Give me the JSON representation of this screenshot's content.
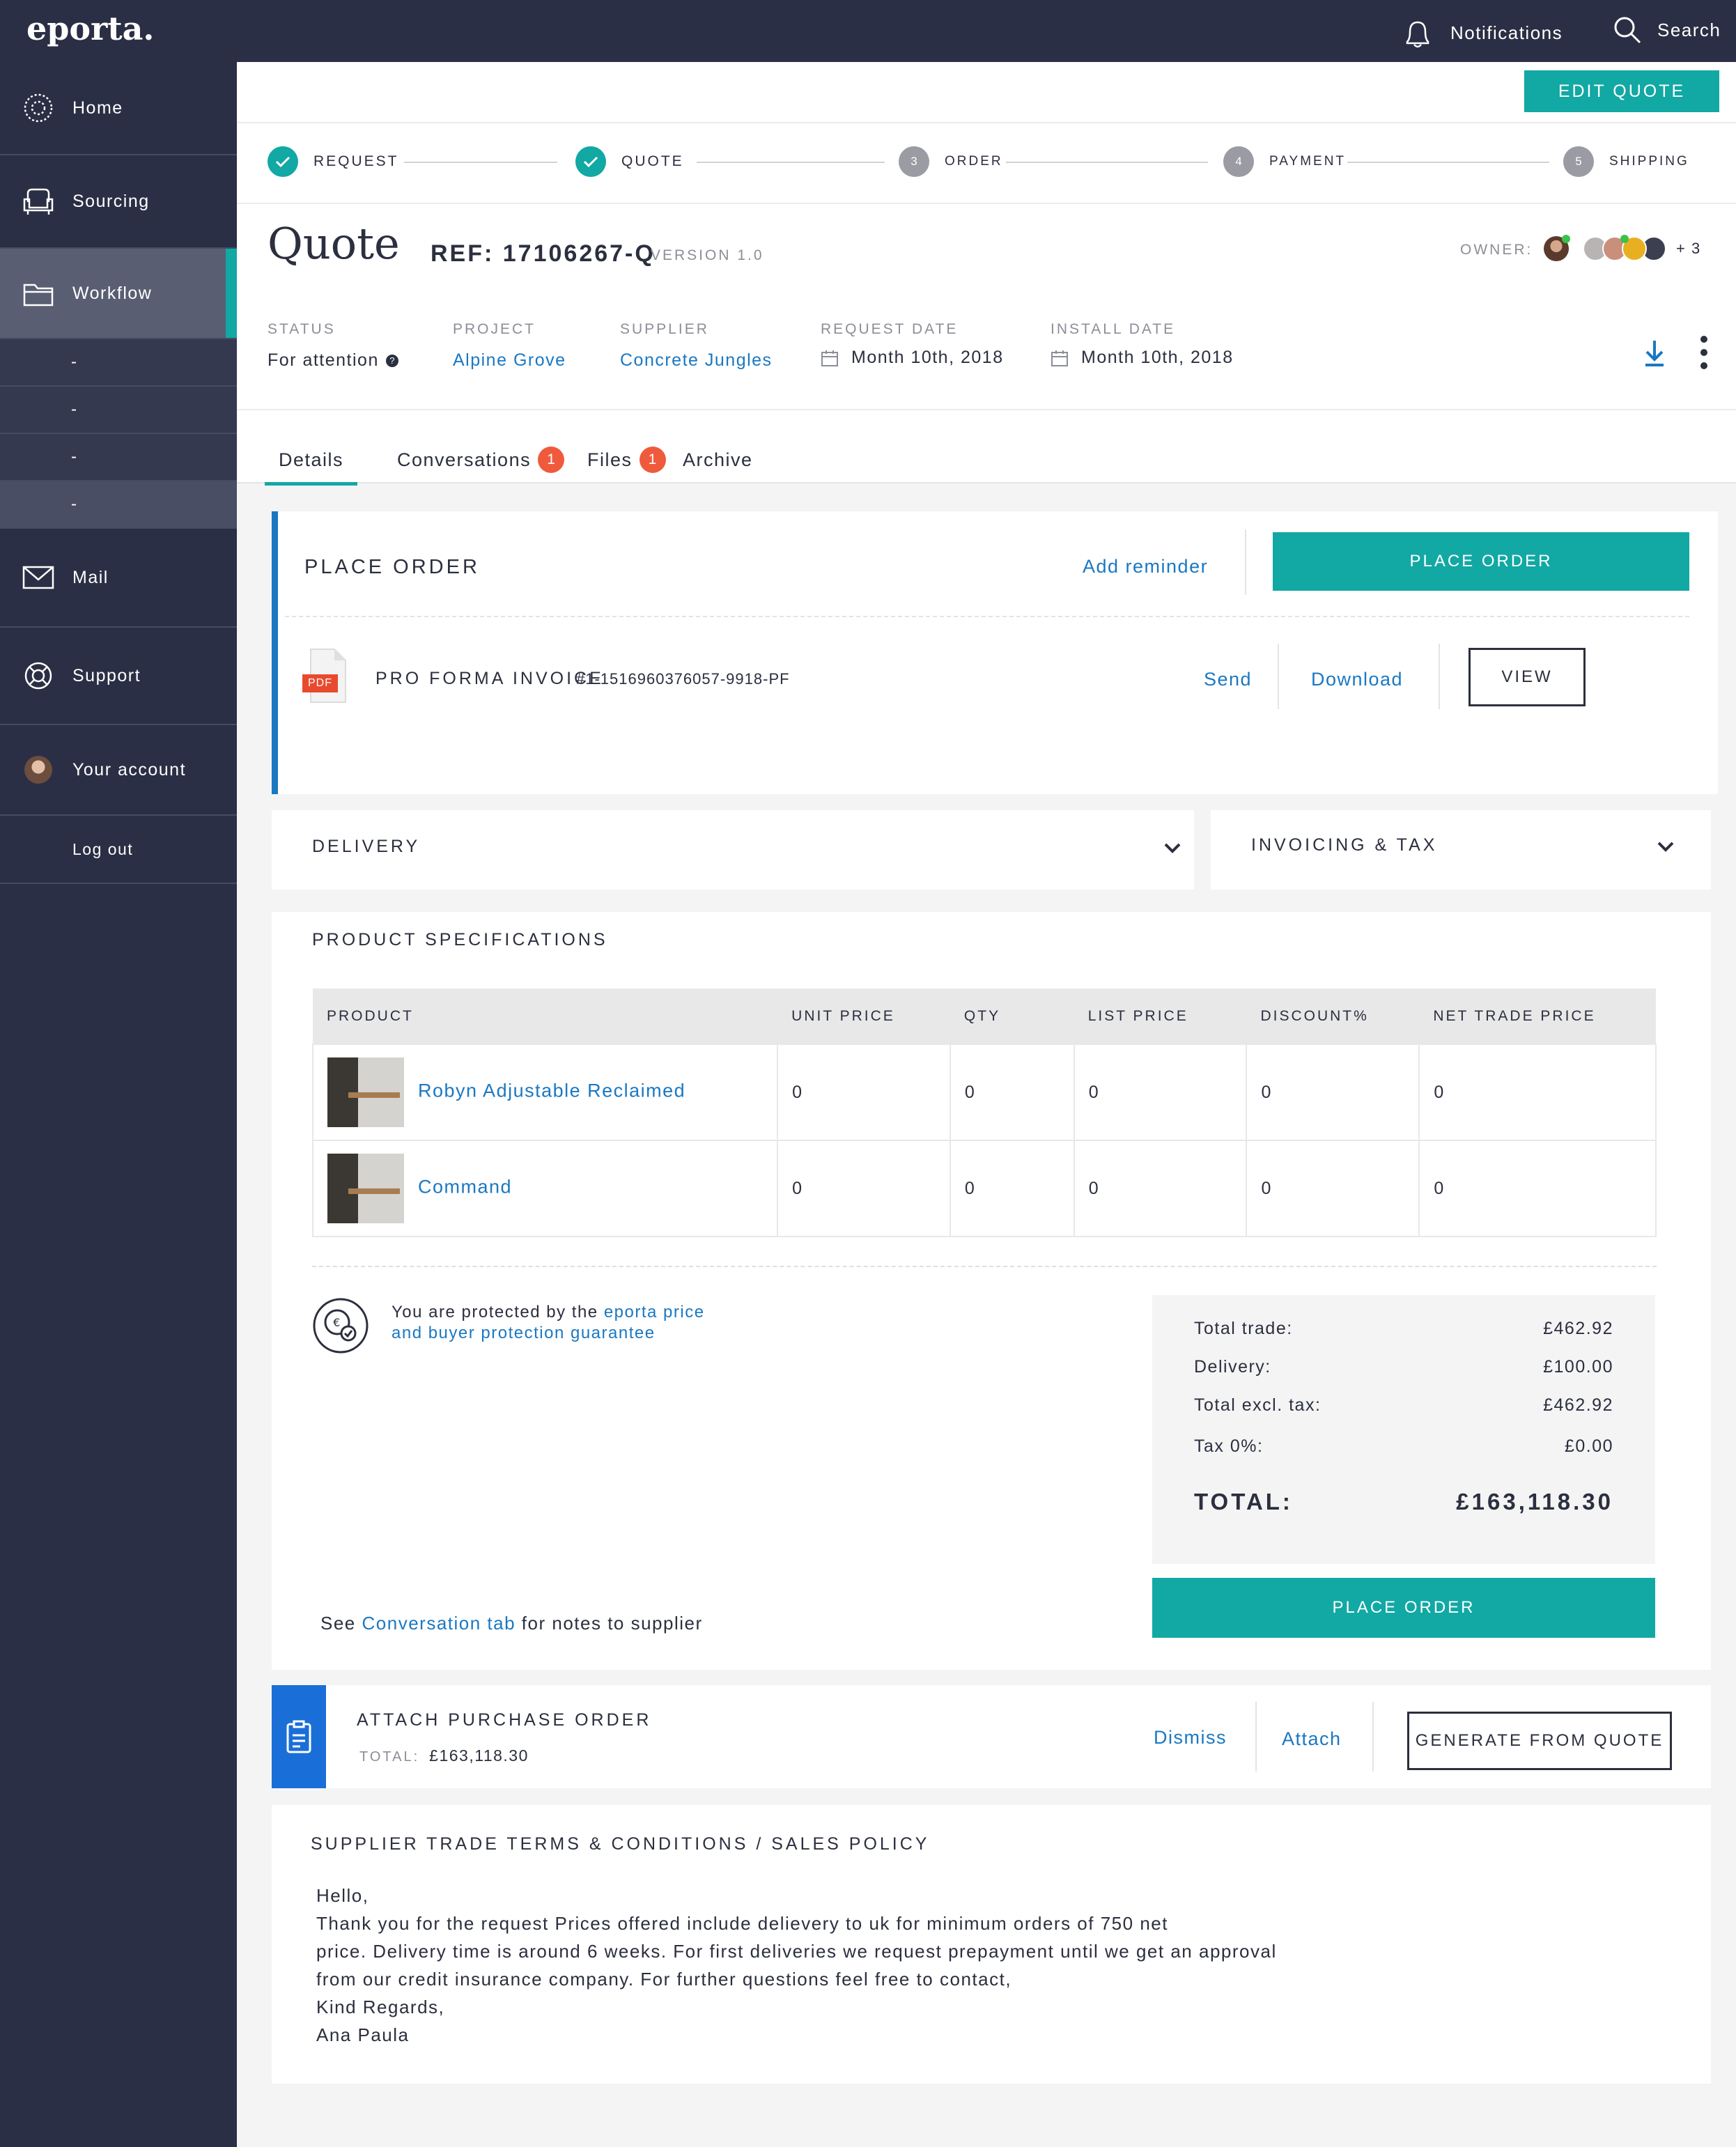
{
  "app": {
    "logo": "eporta."
  },
  "topbar": {
    "notifications": "Notifications",
    "search": "Search"
  },
  "sidebar": {
    "items": [
      {
        "label": "Home",
        "icon": "globe-icon"
      },
      {
        "label": "Sourcing",
        "icon": "armchair-icon"
      },
      {
        "label": "Workflow",
        "icon": "folder-icon"
      },
      {
        "label": "Mail",
        "icon": "envelope-icon"
      },
      {
        "label": "Support",
        "icon": "lifebuoy-icon"
      },
      {
        "label": "Your account",
        "icon": "avatar-icon"
      },
      {
        "label": "Log out"
      }
    ],
    "sub_items": [
      "-",
      "-",
      "-",
      "-"
    ]
  },
  "header": {
    "edit_quote": "EDIT QUOTE",
    "steps": [
      {
        "label": "REQUEST",
        "state": "done"
      },
      {
        "label": "QUOTE",
        "state": "done"
      },
      {
        "label": "ORDER",
        "number": "3"
      },
      {
        "label": "PAYMENT",
        "number": "4"
      },
      {
        "label": "SHIPPING",
        "number": "5"
      }
    ],
    "title": "Quote",
    "ref": "REF: 17106267-Q",
    "version": "VERSION 1.0",
    "owner_label": "OWNER:",
    "owner_more": "+ 3",
    "meta": {
      "status_label": "STATUS",
      "status_value": "For attention",
      "project_label": "PROJECT",
      "project_value": "Alpine Grove",
      "supplier_label": "SUPPLIER",
      "supplier_value": "Concrete Jungles",
      "request_date_label": "REQUEST DATE",
      "request_date_value": "Month 10th, 2018",
      "install_date_label": "INSTALL DATE",
      "install_date_value": "Month 10th, 2018"
    }
  },
  "tabs": [
    {
      "label": "Details"
    },
    {
      "label": "Conversations",
      "badge": "1"
    },
    {
      "label": "Files",
      "badge": "1"
    },
    {
      "label": "Archive"
    }
  ],
  "place_order": {
    "title": "PLACE ORDER",
    "add_reminder": "Add reminder",
    "button": "PLACE ORDER",
    "invoice_badge": "PDF",
    "invoice_title": "PRO FORMA INVOICE",
    "invoice_number": "#1-1516960376057-9918-PF",
    "send": "Send",
    "download": "Download",
    "view": "VIEW"
  },
  "delivery": {
    "title": "DELIVERY"
  },
  "invoicing": {
    "title": "INVOICING & TAX"
  },
  "specs": {
    "title": "PRODUCT SPECIFICATIONS",
    "columns": [
      "PRODUCT",
      "UNIT PRICE",
      "QTY",
      "LIST PRICE",
      "DISCOUNT%",
      "NET TRADE PRICE"
    ],
    "rows": [
      {
        "product": "Robyn Adjustable Reclaimed",
        "unit_price": "0",
        "qty": "0",
        "list_price": "0",
        "discount": "0",
        "net": "0"
      },
      {
        "product": "Command",
        "unit_price": "0",
        "qty": "0",
        "list_price": "0",
        "discount": "0",
        "net": "0"
      }
    ],
    "protection_text": "You are protected by the",
    "protection_link_1": "eporta price",
    "protection_link_2": "and buyer protection guarantee",
    "see_text": "See",
    "see_link": "Conversation tab",
    "see_suffix": "for notes to supplier",
    "totals": {
      "trade_label": "Total trade:",
      "trade_value": "£462.92",
      "delivery_label": "Delivery:",
      "delivery_value": "£100.00",
      "excl_label": "Total excl. tax:",
      "excl_value": "£462.92",
      "tax_label": "Tax 0%:",
      "tax_value": "£0.00",
      "total_label": "TOTAL:",
      "total_value": "£163,118.30"
    },
    "place_order": "PLACE ORDER"
  },
  "purchase_order": {
    "title": "ATTACH PURCHASE ORDER",
    "total_label": "TOTAL:",
    "total_value": "£163,118.30",
    "dismiss": "Dismiss",
    "attach": "Attach",
    "generate": "GENERATE FROM QUOTE"
  },
  "terms": {
    "title": "SUPPLIER TRADE TERMS & CONDITIONS / SALES POLICY",
    "lines": [
      "Hello,",
      "Thank you for the request Prices offered include delievery to uk for minimum orders of 750 net",
      "price. Delivery time is around 6 weeks. For first deliveries we request prepayment until we get an approval",
      "from our credit insurance company. For further questions feel free to contact,",
      "Kind Regards,",
      "Ana Paula"
    ]
  },
  "colors": {
    "navy": "#2b2f45",
    "teal": "#12a8a4",
    "blue": "#1a78c2",
    "badge": "#f05a3c"
  }
}
